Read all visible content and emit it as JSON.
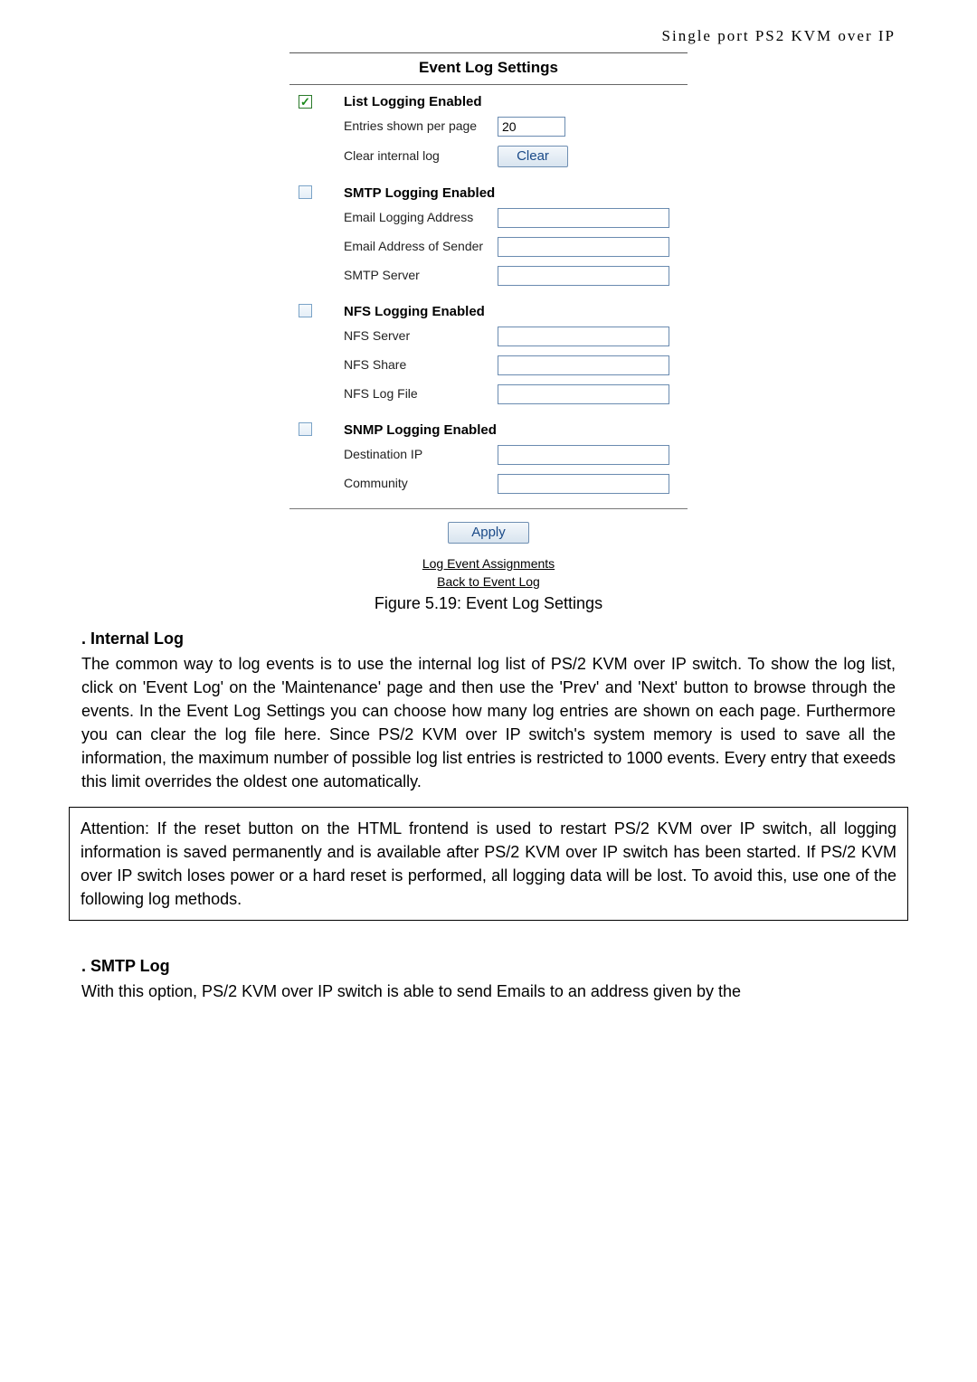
{
  "header": "Single port PS2 KVM over IP",
  "panel": {
    "title": "Event Log Settings",
    "sections": {
      "list": {
        "label": "List Logging Enabled",
        "entries_label": "Entries shown per page",
        "entries_value": "20",
        "clear_label": "Clear internal log",
        "clear_button": "Clear"
      },
      "smtp": {
        "label": "SMTP Logging Enabled",
        "email_logging_label": "Email Logging Address",
        "sender_label": "Email Address of Sender",
        "server_label": "SMTP Server"
      },
      "nfs": {
        "label": "NFS Logging Enabled",
        "server_label": "NFS Server",
        "share_label": "NFS Share",
        "logfile_label": "NFS Log File"
      },
      "snmp": {
        "label": "SNMP Logging Enabled",
        "dest_label": "Destination IP",
        "community_label": "Community"
      }
    },
    "apply_button": "Apply",
    "link1": "Log Event Assignments",
    "link2": "Back to Event Log"
  },
  "caption": "Figure 5.19: Event Log Settings",
  "internal_log": {
    "heading": ". Internal Log",
    "text": "The common way to log events is to use the internal log list of PS/2 KVM over IP switch. To show the log list, click on 'Event Log' on the 'Maintenance' page and then use the 'Prev' and 'Next' button to browse through the events. In the Event Log Settings you can choose how many log entries are shown on each page. Furthermore you can clear the log file here. Since PS/2 KVM over IP switch's system memory is used to save all the information, the maximum number of possible log list entries is restricted to 1000 events. Every entry that exeeds this limit overrides the oldest one automatically."
  },
  "attention": "Attention: If the reset button on the HTML frontend is used to restart PS/2 KVM over IP switch, all logging information is saved permanently and is available after PS/2 KVM over IP switch has been started. If PS/2 KVM over IP switch loses power or a hard reset is performed, all logging data will be lost. To avoid this, use one of the following log methods.",
  "smtp_log": {
    "heading": ". SMTP Log",
    "text": "With this option, PS/2 KVM over IP switch is able to send Emails to an address given by the"
  }
}
